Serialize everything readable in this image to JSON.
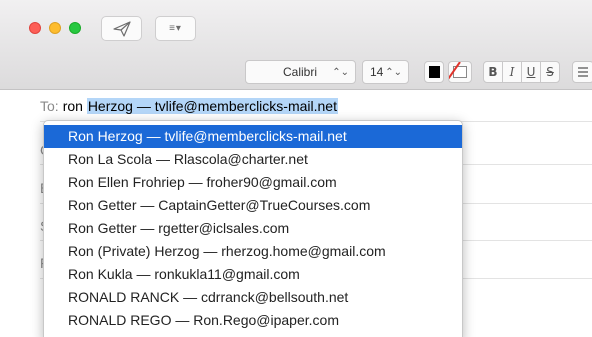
{
  "toolbar": {
    "send_icon": "paper-plane-icon",
    "list_icon": "list-icon",
    "list_glyph": "≡▾"
  },
  "format": {
    "font": "Calibri",
    "size": "14",
    "text_color": "#000000",
    "bold": "B",
    "italic": "I",
    "underline": "U",
    "strike": "S",
    "arrows": "⌃⌄"
  },
  "to_field": {
    "label": "To:",
    "typed": "ron ",
    "completion": "Herzog — tvlife@memberclicks-mail.net"
  },
  "hidden_labels": [
    "C",
    "B",
    "S",
    "F"
  ],
  "suggestions": [
    "Ron Herzog — tvlife@memberclicks-mail.net",
    "Ron La Scola — Rlascola@charter.net",
    "Ron Ellen Frohriep — froher90@gmail.com",
    "Ron Getter — CaptainGetter@TrueCourses.com",
    "Ron Getter — rgetter@iclsales.com",
    "Ron (Private) Herzog — rherzog.home@gmail.com",
    "Ron Kukla — ronkukla11@gmail.com",
    "RONALD RANCK — cdrranck@bellsouth.net",
    "RONALD REGO — Ron.Rego@ipaper.com"
  ],
  "colors": {
    "selection": "#1b69d7",
    "completion_highlight": "#b4d6f8"
  }
}
